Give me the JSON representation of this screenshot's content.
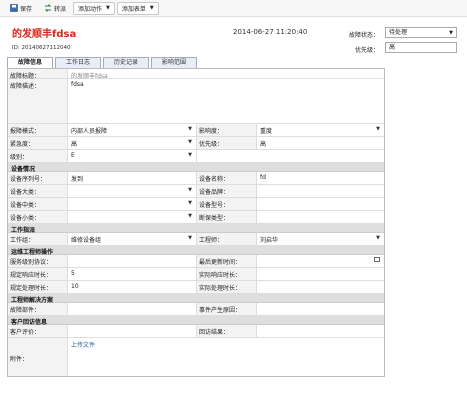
{
  "toolbar": {
    "save": "保存",
    "transfer": "转派",
    "add_action": "添加动作",
    "add_form": "添加表单"
  },
  "header": {
    "title": "的发顺丰fdsa",
    "datetime": "2014-06-27 11:20:40",
    "id_line": "ID: 20140627112040",
    "status_label": "故障状态：",
    "status_value": "待处理",
    "priority_label": "优先级：",
    "priority_value": "高"
  },
  "tabs": [
    "故障信息",
    "工作日志",
    "历史记录",
    "影响范围"
  ],
  "form": {
    "fault_title_label": "故障标题：",
    "fault_title_value": "的发顺丰fdsa",
    "fault_desc_label": "故障描述：",
    "fault_desc_value": "fdsa",
    "report_mode_label": "报障模式：",
    "report_mode_value": "内部人员报障",
    "impact_label": "影响度：",
    "impact_value": "重度",
    "urgency_label": "紧急度：",
    "urgency_value": "高",
    "priority_label": "优先级：",
    "priority_value": "高",
    "level_label": "级别：",
    "level_value": "E",
    "device_section": "设备情况",
    "device_serial_label": "设备序列号：",
    "device_serial_value": "发到",
    "device_name_label": "设备名称：",
    "device_name_value": "fd",
    "device_major_label": "设备大类：",
    "device_brand_label": "设备品牌：",
    "device_mid_label": "设备中类：",
    "device_model_label": "设备型号：",
    "device_minor_label": "设备小类：",
    "fault_type_label": "断保类型：",
    "dispatch_section": "工作指派",
    "work_group_label": "工作组：",
    "work_group_value": "维修设备组",
    "engineer_label": "工程师：",
    "engineer_value": "刘启华",
    "ops_section": "运维工程师操作",
    "service_level_label": "服务级别协议：",
    "latest_update_label": "最后更新时间：",
    "resp_time_label": "规定响应时长：",
    "resp_time_value": "5",
    "actual_resp_label": "实际响应时长：",
    "handle_time_label": "规定处理时长：",
    "handle_time_value": "10",
    "actual_handle_label": "实际处理时长：",
    "solution_section": "工程师解决方案",
    "fault_part_label": "故障部件：",
    "cause_label": "事件产生原因：",
    "visit_section": "客户回访信息",
    "customer_eval_label": "客户评价：",
    "visit_result_label": "回访结果：",
    "attachment_label": "附件：",
    "upload_link": "上传文件"
  }
}
